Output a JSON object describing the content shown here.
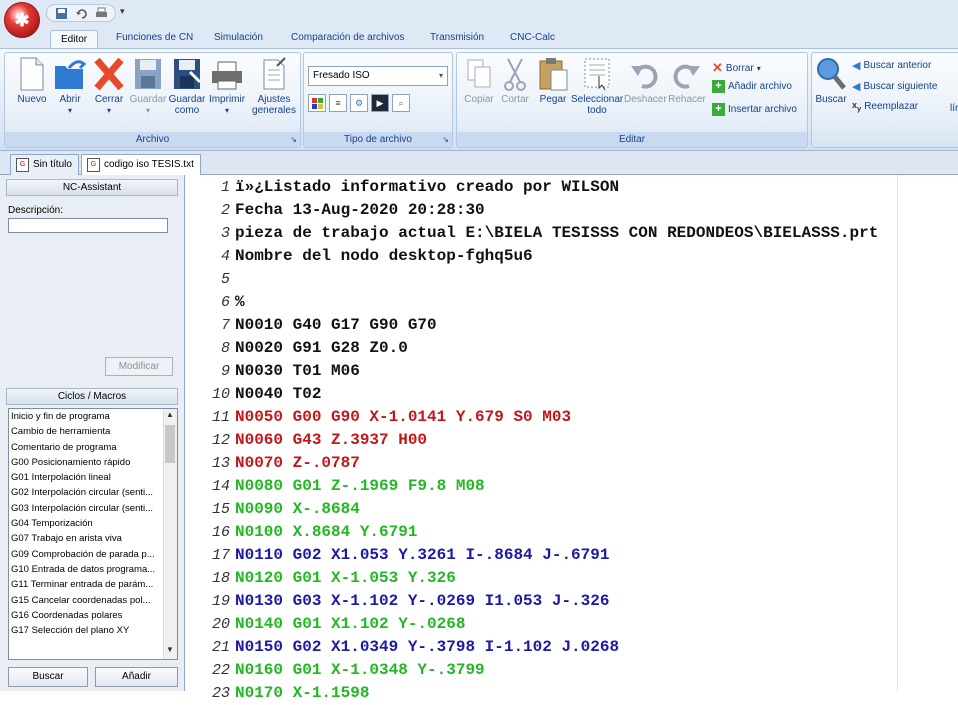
{
  "quick_access": {
    "more_glyph": "▾"
  },
  "ribbon_tabs": [
    "Editor",
    "Funciones de CN",
    "Simulación",
    "Comparación de archivos",
    "Transmisión",
    "CNC-Calc"
  ],
  "groups": {
    "archivo": {
      "label": "Archivo",
      "buttons": {
        "nuevo": "Nuevo",
        "abrir": "Abrir",
        "cerrar": "Cerrar",
        "guardar": "Guardar",
        "guardar_como_1": "Guardar",
        "guardar_como_2": "como",
        "imprimir": "Imprimir",
        "ajustes_1": "Ajustes",
        "ajustes_2": "generales"
      }
    },
    "tipo": {
      "label": "Tipo de archivo",
      "select_value": "Fresado ISO"
    },
    "editar": {
      "label": "Editar",
      "buttons": {
        "copiar": "Copiar",
        "cortar": "Cortar",
        "pegar": "Pegar",
        "seleccionar_1": "Seleccionar",
        "seleccionar_2": "todo",
        "deshacer": "Deshacer",
        "rehacer": "Rehacer",
        "borrar": "Borrar",
        "anadir": "Añadir archivo",
        "insertar": "Insertar archivo"
      }
    },
    "buscar": {
      "buttons": {
        "buscar": "Buscar",
        "anterior": "Buscar anterior",
        "siguiente": "Buscar siguiente",
        "reemplazar": "Reemplazar"
      },
      "cut_label": "lír"
    }
  },
  "doc_tabs": [
    "Sin título",
    "codigo iso TESIS.txt"
  ],
  "left_panel": {
    "nc_assistant": "NC-Assistant",
    "descripcion_label": "Descripción:",
    "descripcion_value": "",
    "modificar": "Modificar",
    "macros_title": "Ciclos / Macros",
    "macros": [
      "Inicio y fin de programa",
      "Cambio de herramienta",
      "Comentario de programa",
      "G00 Posicionamiento rápido",
      "G01 Interpolación lineal",
      "G02 Interpolación circular (senti...",
      "G03 Interpolación circular (senti...",
      "G04 Temporización",
      "G07 Trabajo en arista viva",
      "G09 Comprobación de parada p...",
      "G10 Entrada de datos programa...",
      "G11 Terminar entrada de parám...",
      "G15 Cancelar coordenadas pol...",
      "G16 Coordenadas polares",
      "G17 Selección del plano XY"
    ],
    "buscar_btn": "Buscar",
    "anadir_btn": "Añadir"
  },
  "code_lines": [
    {
      "n": "1",
      "text": "ï»¿Listado informativo creado por       WILSON",
      "color": "black"
    },
    {
      "n": "2",
      "text": "Fecha   13-Aug-2020 20:28:30",
      "color": "black"
    },
    {
      "n": "3",
      "text": "pieza de trabajo actual E:\\BIELA TESISSS CON REDONDEOS\\BIELASSS.prt",
      "color": "black"
    },
    {
      "n": "4",
      "text": "Nombre del nodo desktop-fghq5u6",
      "color": "black"
    },
    {
      "n": "5",
      "text": "",
      "color": "black"
    },
    {
      "n": "6",
      "text": "%",
      "color": "black"
    },
    {
      "n": "7",
      "text": "N0010 G40 G17 G90 G70",
      "color": "black"
    },
    {
      "n": "8",
      "text": "N0020 G91 G28 Z0.0",
      "color": "black"
    },
    {
      "n": "9",
      "text": "N0030 T01 M06",
      "color": "black"
    },
    {
      "n": "10",
      "text": "N0040 T02",
      "color": "black"
    },
    {
      "n": "11",
      "text": "N0050 G00 G90 X-1.0141 Y.679 S0 M03",
      "color": "red"
    },
    {
      "n": "12",
      "text": "N0060 G43 Z.3937 H00",
      "color": "red"
    },
    {
      "n": "13",
      "text": "N0070 Z-.0787",
      "color": "red"
    },
    {
      "n": "14",
      "text": "N0080 G01 Z-.1969 F9.8 M08",
      "color": "green"
    },
    {
      "n": "15",
      "text": "N0090 X-.8684",
      "color": "green"
    },
    {
      "n": "16",
      "text": "N0100 X.8684 Y.6791",
      "color": "green"
    },
    {
      "n": "17",
      "text": "N0110 G02 X1.053 Y.3261 I-.8684 J-.6791",
      "color": "blue"
    },
    {
      "n": "18",
      "text": "N0120 G01 X-1.053 Y.326",
      "color": "green"
    },
    {
      "n": "19",
      "text": "N0130 G03 X-1.102 Y-.0269 I1.053 J-.326",
      "color": "blue"
    },
    {
      "n": "20",
      "text": "N0140 G01 X1.102 Y-.0268",
      "color": "green"
    },
    {
      "n": "21",
      "text": "N0150 G02 X1.0349 Y-.3798 I-1.102 J.0268",
      "color": "blue"
    },
    {
      "n": "22",
      "text": "N0160 G01 X-1.0348 Y-.3799",
      "color": "green"
    },
    {
      "n": "23",
      "text": "N0170 X-1.1598",
      "color": "green"
    }
  ],
  "colors": {
    "black": "#111111",
    "red": "#c0171a",
    "green": "#23b823",
    "blue": "#1a1aa6",
    "ribbon_text": "#15428b"
  }
}
